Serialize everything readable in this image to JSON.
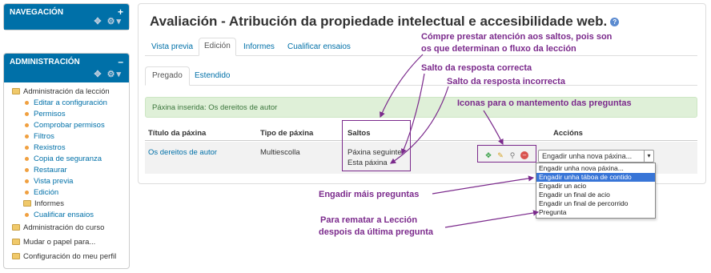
{
  "nav_block": {
    "title": "NAVEGACIÓN",
    "ctrl": "+"
  },
  "admin_block": {
    "title": "ADMINISTRACIÓN",
    "ctrl": "–",
    "items": [
      {
        "label": "Administración da lección",
        "kind": "root"
      },
      {
        "label": "Editar a configuración",
        "kind": "child"
      },
      {
        "label": "Permisos",
        "kind": "child"
      },
      {
        "label": "Comprobar permisos",
        "kind": "child"
      },
      {
        "label": "Filtros",
        "kind": "child"
      },
      {
        "label": "Rexistros",
        "kind": "child"
      },
      {
        "label": "Copia de seguranza",
        "kind": "child"
      },
      {
        "label": "Restaurar",
        "kind": "child"
      },
      {
        "label": "Vista previa",
        "kind": "child"
      },
      {
        "label": "Edición",
        "kind": "child"
      },
      {
        "label": "Informes",
        "kind": "folder"
      },
      {
        "label": "Cualificar ensaios",
        "kind": "child"
      },
      {
        "label": "Administración do curso",
        "kind": "root"
      },
      {
        "label": "Mudar o papel para...",
        "kind": "root"
      },
      {
        "label": "Configuración do meu perfil",
        "kind": "root"
      }
    ]
  },
  "main": {
    "title": "Avaliación - Atribución da propiedade intelectual e accesibilidade web.",
    "help": "?",
    "tabs": [
      "Vista previa",
      "Edición",
      "Informes",
      "Cualificar ensaios"
    ],
    "subtabs": [
      "Pregado",
      "Estendido"
    ],
    "notice": "Páxina inserida: Os dereitos de autor",
    "table": {
      "headers": [
        "Título da páxina",
        "Tipo de páxina",
        "Saltos",
        "Accións"
      ],
      "row": {
        "title": "Os dereitos de autor",
        "type": "Multiescolla",
        "jumps": [
          "Páxina seguinte",
          "Esta páxina"
        ]
      }
    },
    "select": {
      "value": "Engadir unha nova páxina...",
      "options": [
        "Engadir unha nova páxina...",
        "Engadir unha táboa de contido",
        "Engadir un acio",
        "Engadir un final de acio",
        "Engadir un final de percorrido",
        "Pregunta"
      ],
      "highlighted_index": 1
    }
  },
  "annotations": {
    "jumps_note_1": "Cómpre prestar atención aos saltos, pois son",
    "jumps_note_2": "os que determinan o fluxo da lección",
    "correct": "Salto da resposta correcta",
    "incorrect": "Salto da resposta incorrecta",
    "icons": "Iconas para o mantemento das preguntas",
    "add_more": "Engadir máis preguntas",
    "finish_1": "Para rematar a Lección",
    "finish_2": "despois da última pregunta"
  },
  "colors": {
    "annotation": "#7b2a8c",
    "header": "#0070a8",
    "highlight": "#3875d7"
  }
}
